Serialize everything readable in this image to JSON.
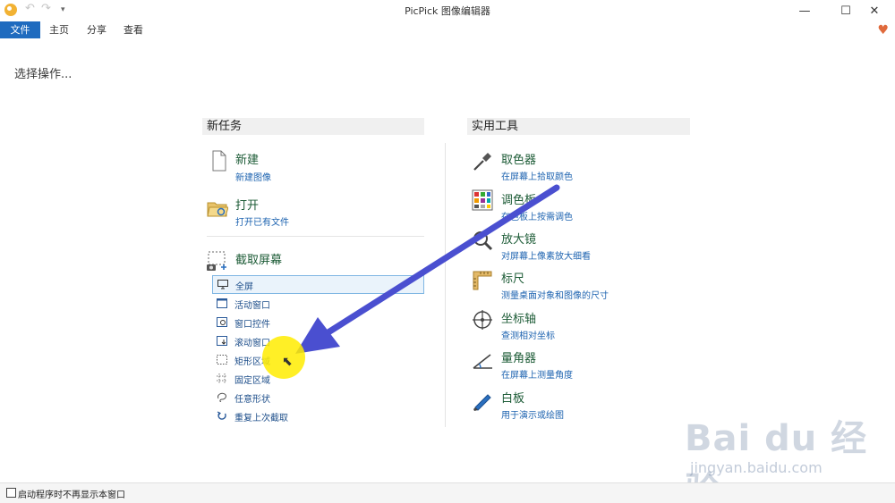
{
  "window": {
    "title": "PicPick 图像编辑器",
    "undo_icon": "↶",
    "redo_icon": "↷",
    "customize_icon": "▾",
    "minimize": "—",
    "maximize": "☐",
    "close": "✕"
  },
  "ribbon": {
    "tabs": [
      "文件",
      "主页",
      "分享",
      "查看"
    ],
    "heart": "♥"
  },
  "prompt": "选择操作...",
  "new_tasks": {
    "header": "新任务",
    "new": {
      "title": "新建",
      "sub": "新建图像"
    },
    "open": {
      "title": "打开",
      "sub": "打开已有文件"
    },
    "capture": {
      "title": "截取屏幕",
      "items": [
        "全屏",
        "活动窗口",
        "窗口控件",
        "滚动窗口",
        "矩形区域",
        "固定区域",
        "任意形状",
        "重复上次截取"
      ]
    }
  },
  "tools": {
    "header": "实用工具",
    "items": [
      {
        "title": "取色器",
        "sub": "在屏幕上拾取颜色"
      },
      {
        "title": "调色板",
        "sub": "在色板上按需调色"
      },
      {
        "title": "放大镜",
        "sub": "对屏幕上像素放大细看"
      },
      {
        "title": "标尺",
        "sub": "测量桌面对象和图像的尺寸"
      },
      {
        "title": "坐标轴",
        "sub": "查测相对坐标"
      },
      {
        "title": "量角器",
        "sub": "在屏幕上测量角度"
      },
      {
        "title": "白板",
        "sub": "用于演示或绘图"
      }
    ]
  },
  "footer": {
    "checkbox_label": "启动程序时不再显示本窗口"
  },
  "watermark": {
    "logo": "Bai du 经验",
    "url": "jingyan.baidu.com"
  },
  "colors": {
    "accent": "#1f6bbf",
    "arrow": "#4a4fd0",
    "highlight": "#ffec00"
  }
}
